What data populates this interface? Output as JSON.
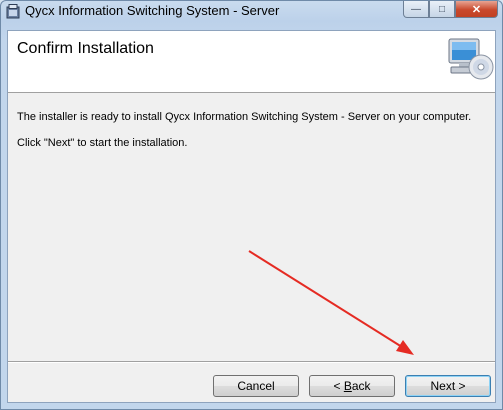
{
  "window": {
    "title": "Qycx Information Switching System - Server"
  },
  "window_controls": {
    "minimize": "—",
    "maximize": "□",
    "close": "✕"
  },
  "header": {
    "title": "Confirm Installation"
  },
  "body": {
    "line1": "The installer is ready to install Qycx Information Switching System - Server on your computer.",
    "line2": "Click \"Next\" to start the installation."
  },
  "buttons": {
    "cancel": "Cancel",
    "back_underline": "B",
    "back_rest": "ack",
    "next": "Next"
  },
  "colors": {
    "accent_arrow": "#e52b23",
    "focus_border": "#3c7fb1"
  },
  "icons": [
    "installer-app-icon",
    "computer-cd-icon",
    "back-chevron-icon",
    "next-chevron-icon"
  ]
}
